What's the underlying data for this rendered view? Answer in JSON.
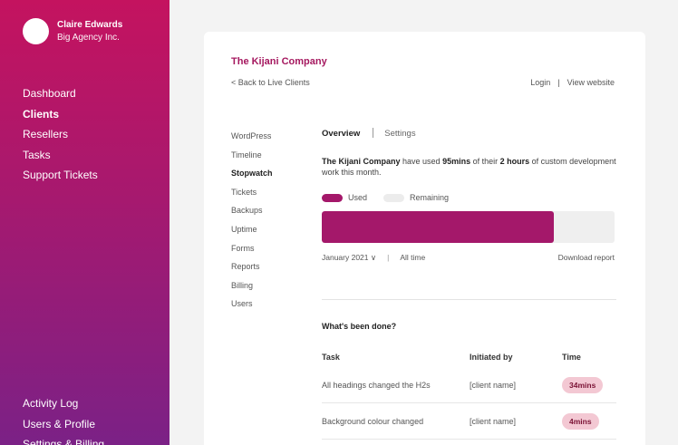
{
  "user": {
    "name": "Claire Edwards",
    "org": "Big Agency Inc."
  },
  "nav": [
    "Dashboard",
    "Clients",
    "Resellers",
    "Tasks",
    "Support Tickets"
  ],
  "bottom_nav": [
    "Activity Log",
    "Users & Profile",
    "Settings & Billing"
  ],
  "client": {
    "title": "The Kijani Company",
    "back_label": "< Back to Live Clients",
    "login_label": "Login",
    "view_website_label": "View website",
    "link_separator": "|"
  },
  "subnav": [
    "WordPress",
    "Timeline",
    "Stopwatch",
    "Tickets",
    "Backups",
    "Uptime",
    "Forms",
    "Reports",
    "Billing",
    "Users"
  ],
  "tabs": {
    "overview": "Overview",
    "settings": "Settings"
  },
  "summary": {
    "company": "The Kijani Company",
    "text1": " have used ",
    "used": "95mins",
    "text2": " of their ",
    "total": "2 hours",
    "text3": " of custom development work this month."
  },
  "legend": {
    "used": "Used",
    "remaining": "Remaining"
  },
  "progress": {
    "used_fraction": 0.7917
  },
  "filters": {
    "month": "January 2021 ∨",
    "separator": "|",
    "all_time": "All time",
    "download": "Download report"
  },
  "done": {
    "title": "What's been done?",
    "headers": {
      "task": "Task",
      "initiated": "Initiated by",
      "time": "Time"
    },
    "rows": [
      {
        "task": "All headings changed the H2s",
        "initiated": "[client name]",
        "time": "34mins"
      },
      {
        "task": "Background colour changed",
        "initiated": "[client name]",
        "time": "4mins"
      }
    ]
  },
  "colors": {
    "accent": "#a4186a",
    "sidebar_top": "#c4135f",
    "sidebar_bottom": "#7b2186",
    "badge_bg": "#f3c8d3"
  }
}
